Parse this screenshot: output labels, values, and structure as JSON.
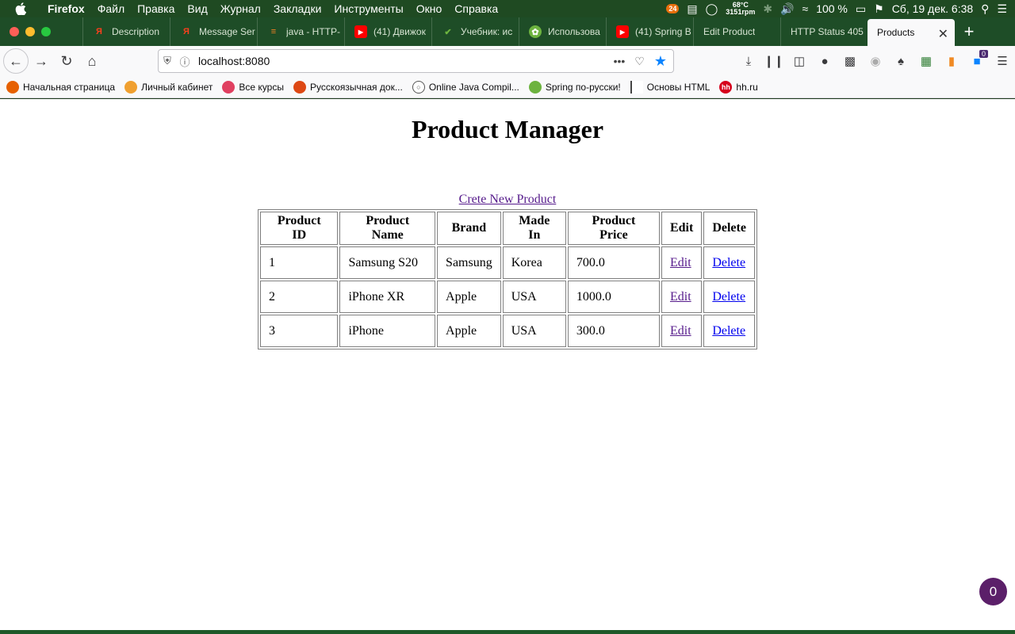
{
  "menubar": {
    "app_name": "Firefox",
    "items": [
      "Файл",
      "Правка",
      "Вид",
      "Журнал",
      "Закладки",
      "Инструменты",
      "Окно",
      "Справка"
    ],
    "notification_count": "24",
    "temperature": "68°C",
    "fan_speed": "3151rpm",
    "battery": "100 %",
    "clock": "Сб, 19 дек.  6:38"
  },
  "tabs": [
    {
      "label": "Description",
      "icon": "yandex-icon"
    },
    {
      "label": "Message Ser",
      "icon": "yandex-icon"
    },
    {
      "label": "java - HTTP-",
      "icon": "stackoverflow-icon"
    },
    {
      "label": "(41) Движок",
      "icon": "youtube-icon"
    },
    {
      "label": "Учебник: ис",
      "icon": "checkmark-icon"
    },
    {
      "label": "Использова",
      "icon": "spring-icon"
    },
    {
      "label": "(41) Spring B",
      "icon": "youtube-icon"
    },
    {
      "label": "Edit Product",
      "icon": ""
    },
    {
      "label": "HTTP Status 405",
      "icon": ""
    },
    {
      "label": "Products",
      "icon": "",
      "active": true
    }
  ],
  "urlbar": {
    "url": "localhost:8080"
  },
  "toolbar": {
    "extension_badge": "0"
  },
  "bookmarks": [
    {
      "label": "Начальная страница",
      "color": "#e66000"
    },
    {
      "label": "Личный кабинет",
      "color": "#f0a030"
    },
    {
      "label": "Все курсы",
      "color": "#e04060"
    },
    {
      "label": "Русскоязычная док...",
      "color": "#dd4814"
    },
    {
      "label": "Online Java Compil...",
      "color": "#555555"
    },
    {
      "label": "Spring по-русски!",
      "color": "#6db33f"
    },
    {
      "label": "Основы HTML",
      "color": "#444444"
    },
    {
      "label": "hh.ru",
      "color": "#d6001c"
    }
  ],
  "page": {
    "title": "Product Manager",
    "create_link": "Crete New Product",
    "table": {
      "headers": [
        "Product ID",
        "Product Name",
        "Brand",
        "Made In",
        "Product Price",
        "Edit",
        "Delete"
      ],
      "rows": [
        {
          "id": "1",
          "name": "Samsung S20",
          "brand": "Samsung",
          "made_in": "Korea",
          "price": "700.0",
          "edit": "Edit",
          "delete": "Delete"
        },
        {
          "id": "2",
          "name": "iPhone XR",
          "brand": "Apple",
          "made_in": "USA",
          "price": "1000.0",
          "edit": "Edit",
          "delete": "Delete"
        },
        {
          "id": "3",
          "name": "iPhone",
          "brand": "Apple",
          "made_in": "USA",
          "price": "300.0",
          "edit": "Edit",
          "delete": "Delete"
        }
      ]
    }
  },
  "floating_counter": "0"
}
